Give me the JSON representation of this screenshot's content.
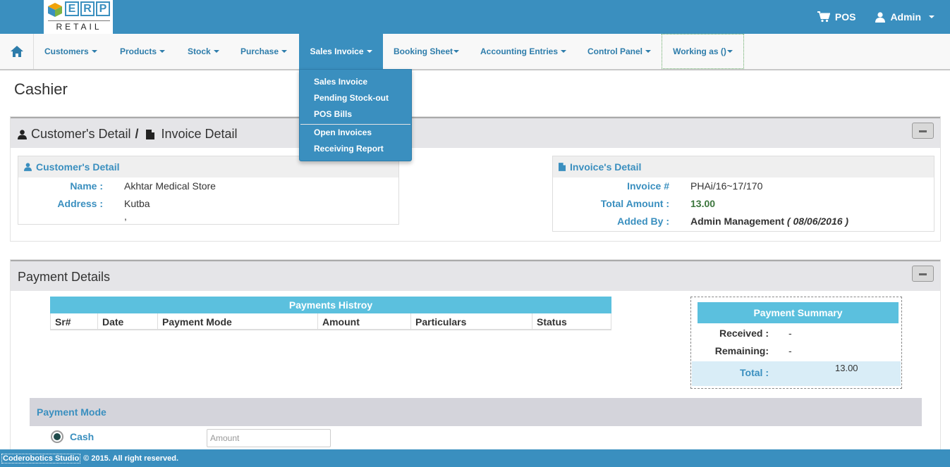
{
  "app": {
    "logo_letters": [
      "E",
      "R",
      "P"
    ],
    "logo_subtitle": "RETAIL",
    "brand_color": "#3a8fbf"
  },
  "topbar": {
    "pos_label": "POS",
    "user_label": "Admin"
  },
  "nav": {
    "items": [
      {
        "label": "Customers"
      },
      {
        "label": "Products"
      },
      {
        "label": "Stock"
      },
      {
        "label": "Purchase"
      },
      {
        "label": "Sales Invoice"
      },
      {
        "label": "Booking Sheet"
      },
      {
        "label": "Accounting Entries"
      },
      {
        "label": "Control Panel"
      },
      {
        "label": "Working as ()"
      }
    ],
    "active": "Sales Invoice",
    "dropdown": [
      "Sales Invoice",
      "Pending Stock-out",
      "POS Bills",
      "Open Invoices",
      "Receiving Report"
    ]
  },
  "page": {
    "title": "Cashier"
  },
  "detail_panel": {
    "title_part1": "Customer's Detail",
    "separator": "/",
    "title_part2": "Invoice Detail",
    "customer": {
      "heading": "Customer's Detail",
      "name_label": "Name :",
      "name_value": "Akhtar Medical Store",
      "address_label": "Address :",
      "address_line1": "Kutba",
      "address_line2": ","
    },
    "invoice": {
      "heading": "Invoice's Detail",
      "invoice_label": "Invoice #",
      "invoice_value": "PHAi/16~17/170",
      "total_label": "Total Amount :",
      "total_value": "13.00",
      "added_label": "Added By :",
      "added_value": "Admin Management",
      "added_date": "( 08/06/2016 )"
    }
  },
  "payment_panel": {
    "title": "Payment Details",
    "history": {
      "title": "Payments Histroy",
      "columns": [
        "Sr#",
        "Date",
        "Payment Mode",
        "Amount",
        "Particulars",
        "Status"
      ]
    },
    "summary": {
      "title": "Payment Summary",
      "received_label": "Received :",
      "received_value": "-",
      "remaining_label": "Remaining:",
      "remaining_value": "-",
      "total_label": "Total :",
      "total_value": "13.00"
    },
    "mode": {
      "heading": "Payment Mode",
      "cash_label": "Cash",
      "amount_placeholder": "Amount"
    }
  },
  "footer": {
    "studio": "Coderobotics Studio",
    "copyright": "© 2015. All right reserved."
  }
}
